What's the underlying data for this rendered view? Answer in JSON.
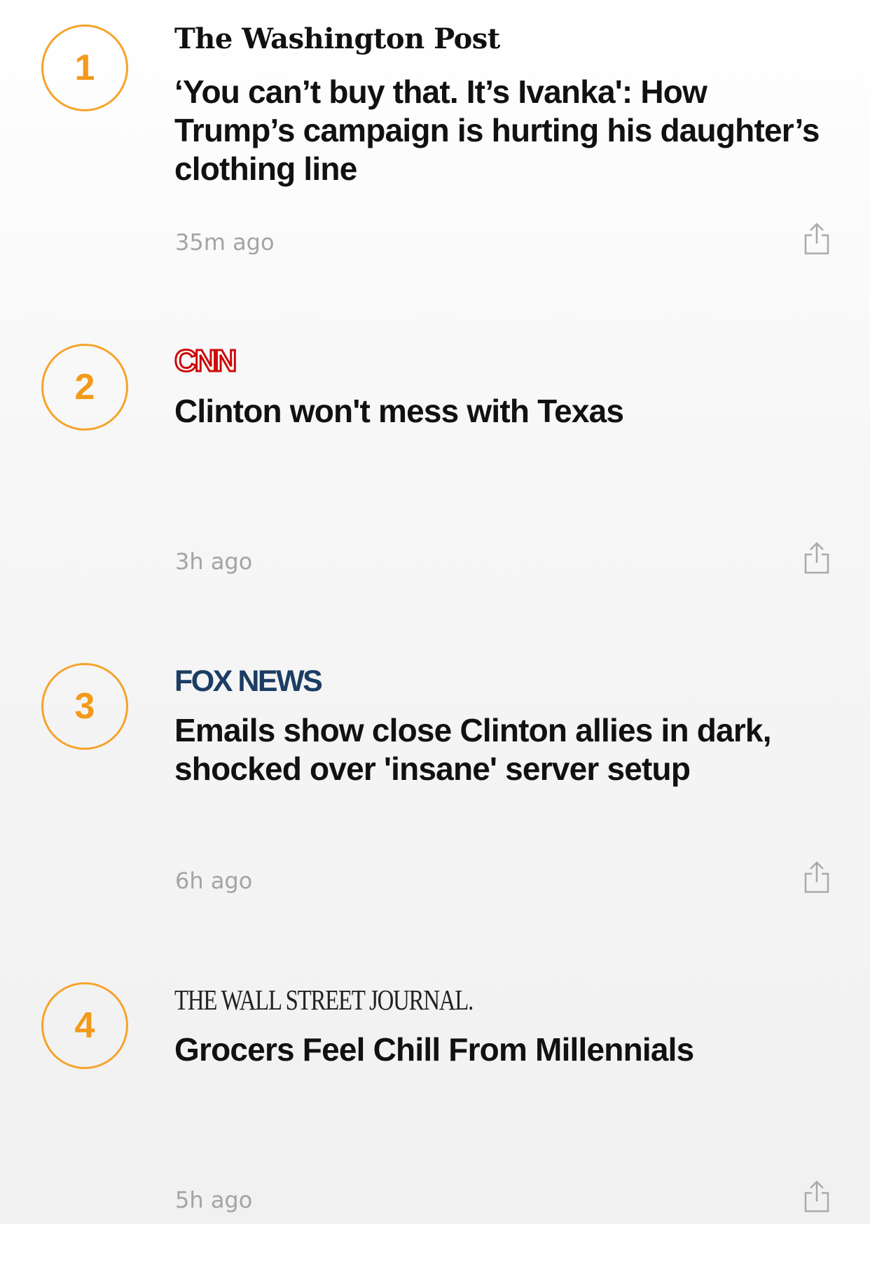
{
  "accent_color": "#f39a1a",
  "stories": [
    {
      "rank": "1",
      "source": "The Washington Post",
      "headline": "‘You can’t buy that. It’s Ivanka': How Trump’s campaign is hurting his daughter’s clothing line",
      "time": "35m ago",
      "share_icon": "share-icon"
    },
    {
      "rank": "2",
      "source": "CNN",
      "headline": "Clinton won't mess with Texas",
      "time": "3h ago",
      "share_icon": "share-icon"
    },
    {
      "rank": "3",
      "source": "FOX NEWS",
      "headline": "Emails show close Clinton allies in dark, shocked over 'insane' server setup",
      "time": "6h ago",
      "share_icon": "share-icon"
    },
    {
      "rank": "4",
      "source": "THE WALL STREET JOURNAL.",
      "headline": "Grocers Feel Chill From Millennials",
      "time": "5h ago",
      "share_icon": "share-icon"
    }
  ]
}
